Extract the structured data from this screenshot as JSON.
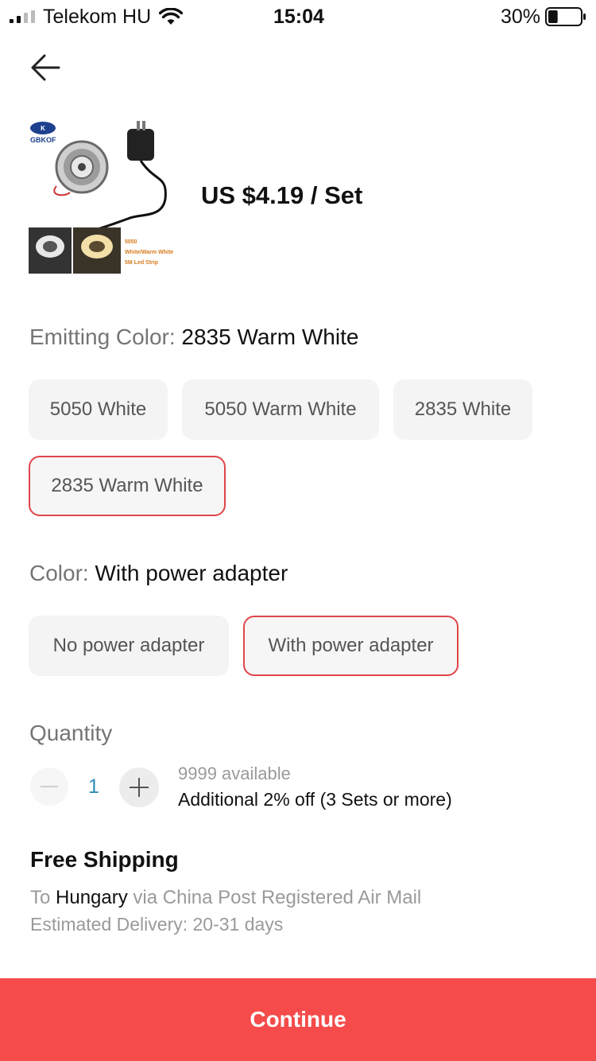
{
  "status_bar": {
    "carrier": "Telekom HU",
    "time": "15:04",
    "battery_percent": "30%",
    "battery_level": 0.3,
    "signal_icon": "cellular-signal-icon",
    "wifi_icon": "wifi-icon"
  },
  "nav": {
    "back_icon": "arrow-left-icon"
  },
  "product": {
    "image_brand": "GBKOF",
    "image_caption": [
      "5050",
      "White/Warm White",
      "5M Led Strip"
    ],
    "price": "US $4.19 / Set"
  },
  "emitting_color": {
    "label": "Emitting Color:",
    "selected": "2835 Warm White",
    "options": [
      "5050 White",
      "5050 Warm White",
      "2835 White",
      "2835 Warm White"
    ]
  },
  "color": {
    "label": "Color:",
    "selected": "With power adapter",
    "options": [
      "No power adapter",
      "With power adapter"
    ]
  },
  "quantity": {
    "label": "Quantity",
    "value": "1",
    "available": "9999 available",
    "discount": "Additional 2% off (3 Sets or more)"
  },
  "shipping": {
    "title": "Free Shipping",
    "to_prefix": "To",
    "destination": "Hungary",
    "via": "via China Post Registered Air Mail",
    "estimate": "Estimated Delivery: 20-31 days"
  },
  "continue_label": "Continue",
  "colors": {
    "accent": "#f54b4b",
    "selected_border": "#e0464a",
    "quantity_value": "#2e8ab8"
  }
}
